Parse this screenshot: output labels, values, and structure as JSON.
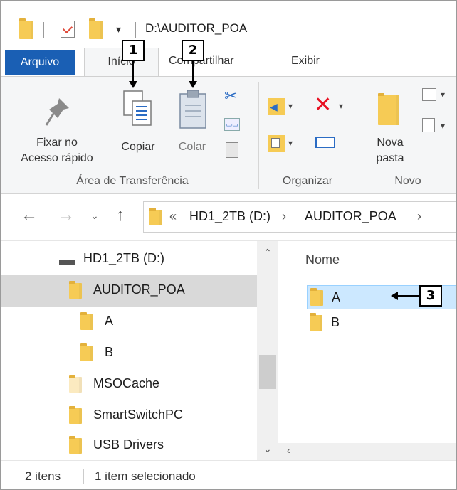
{
  "title_bar": {
    "path": "D:\\AUDITOR_POA"
  },
  "ribbon_tabs": {
    "arquivo": "Arquivo",
    "inicio": "Início",
    "compartilhar": "Compartilhar",
    "exibir": "Exibir"
  },
  "ribbon": {
    "pin_label_1": "Fixar no",
    "pin_label_2": "Acesso rápido",
    "copy_label": "Copiar",
    "paste_label": "Colar",
    "group_clipboard": "Área de Transferência",
    "group_organize": "Organizar",
    "new_folder_1": "Nova",
    "new_folder_2": "pasta",
    "group_new": "Novo"
  },
  "address": {
    "overflow": "«",
    "crumb_drive": "HD1_2TB (D:)",
    "sep1": "›",
    "crumb_folder": "AUDITOR_POA",
    "sep2": "›"
  },
  "nav_items": [
    {
      "label": "HD1_2TB (D:)"
    },
    {
      "label": "AUDITOR_POA"
    },
    {
      "label": "A"
    },
    {
      "label": "B"
    },
    {
      "label": "MSOCache"
    },
    {
      "label": "SmartSwitchPC"
    },
    {
      "label": "USB Drivers"
    }
  ],
  "file_pane": {
    "column_name": "Nome",
    "items": [
      {
        "label": "A"
      },
      {
        "label": "B"
      }
    ]
  },
  "status": {
    "count": "2 itens",
    "selected": "1 item selecionado"
  },
  "callouts": {
    "one": "1",
    "two": "2",
    "three": "3"
  },
  "colors": {
    "accent": "#1a5fb4",
    "folder": "#f6cb55",
    "selection": "#cce8ff",
    "delete_red": "#e81123"
  }
}
